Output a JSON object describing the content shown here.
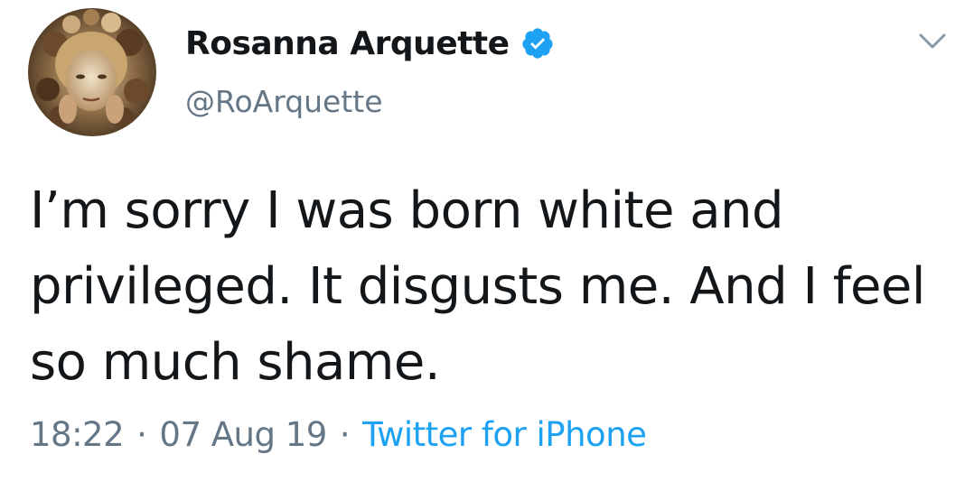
{
  "tweet": {
    "author": {
      "display_name": "Rosanna Arquette",
      "handle": "@RoArquette",
      "verified": true,
      "avatar_icon": "profile-avatar-photo"
    },
    "text": "I’m sorry I was born white and privileged. It disgusts me. And I feel so much shame.",
    "time": "18:22",
    "separator": "·",
    "date": "07 Aug 19",
    "source": "Twitter for iPhone",
    "menu_icon": "chevron-down-icon"
  },
  "colors": {
    "text_primary": "#14171a",
    "text_secondary": "#657786",
    "accent": "#1da1f2",
    "background": "#ffffff"
  }
}
